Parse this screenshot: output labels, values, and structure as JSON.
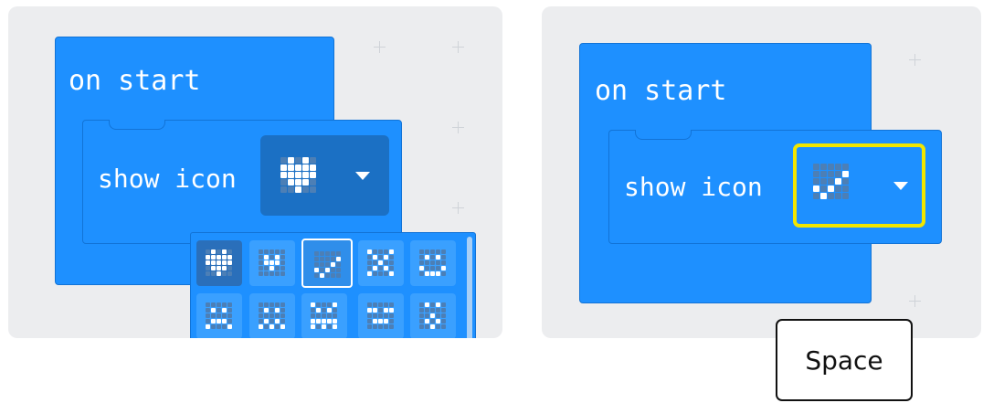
{
  "left_panel": {
    "hat_label": "on start",
    "statement_label": "show icon",
    "field_icon": "heart-icon",
    "picker": {
      "icons": [
        {
          "name": "heart-icon",
          "state": "selected"
        },
        {
          "name": "small-heart-icon",
          "state": "normal"
        },
        {
          "name": "yes-icon",
          "state": "hover"
        },
        {
          "name": "no-icon",
          "state": "normal"
        },
        {
          "name": "happy-icon",
          "state": "normal"
        },
        {
          "name": "sad-icon",
          "state": "normal"
        },
        {
          "name": "confused-icon",
          "state": "normal"
        },
        {
          "name": "angry-icon",
          "state": "normal"
        },
        {
          "name": "asleep-icon",
          "state": "normal"
        },
        {
          "name": "surprised-icon",
          "state": "normal"
        }
      ]
    }
  },
  "right_panel": {
    "hat_label": "on start",
    "statement_label": "show icon",
    "field_icon": "yes-icon"
  },
  "key": {
    "label": "Space"
  },
  "colors": {
    "block": "#1e90ff",
    "block_border": "#1273d6",
    "focus_outline": "#f2e600",
    "workspace": "#ecedef"
  }
}
